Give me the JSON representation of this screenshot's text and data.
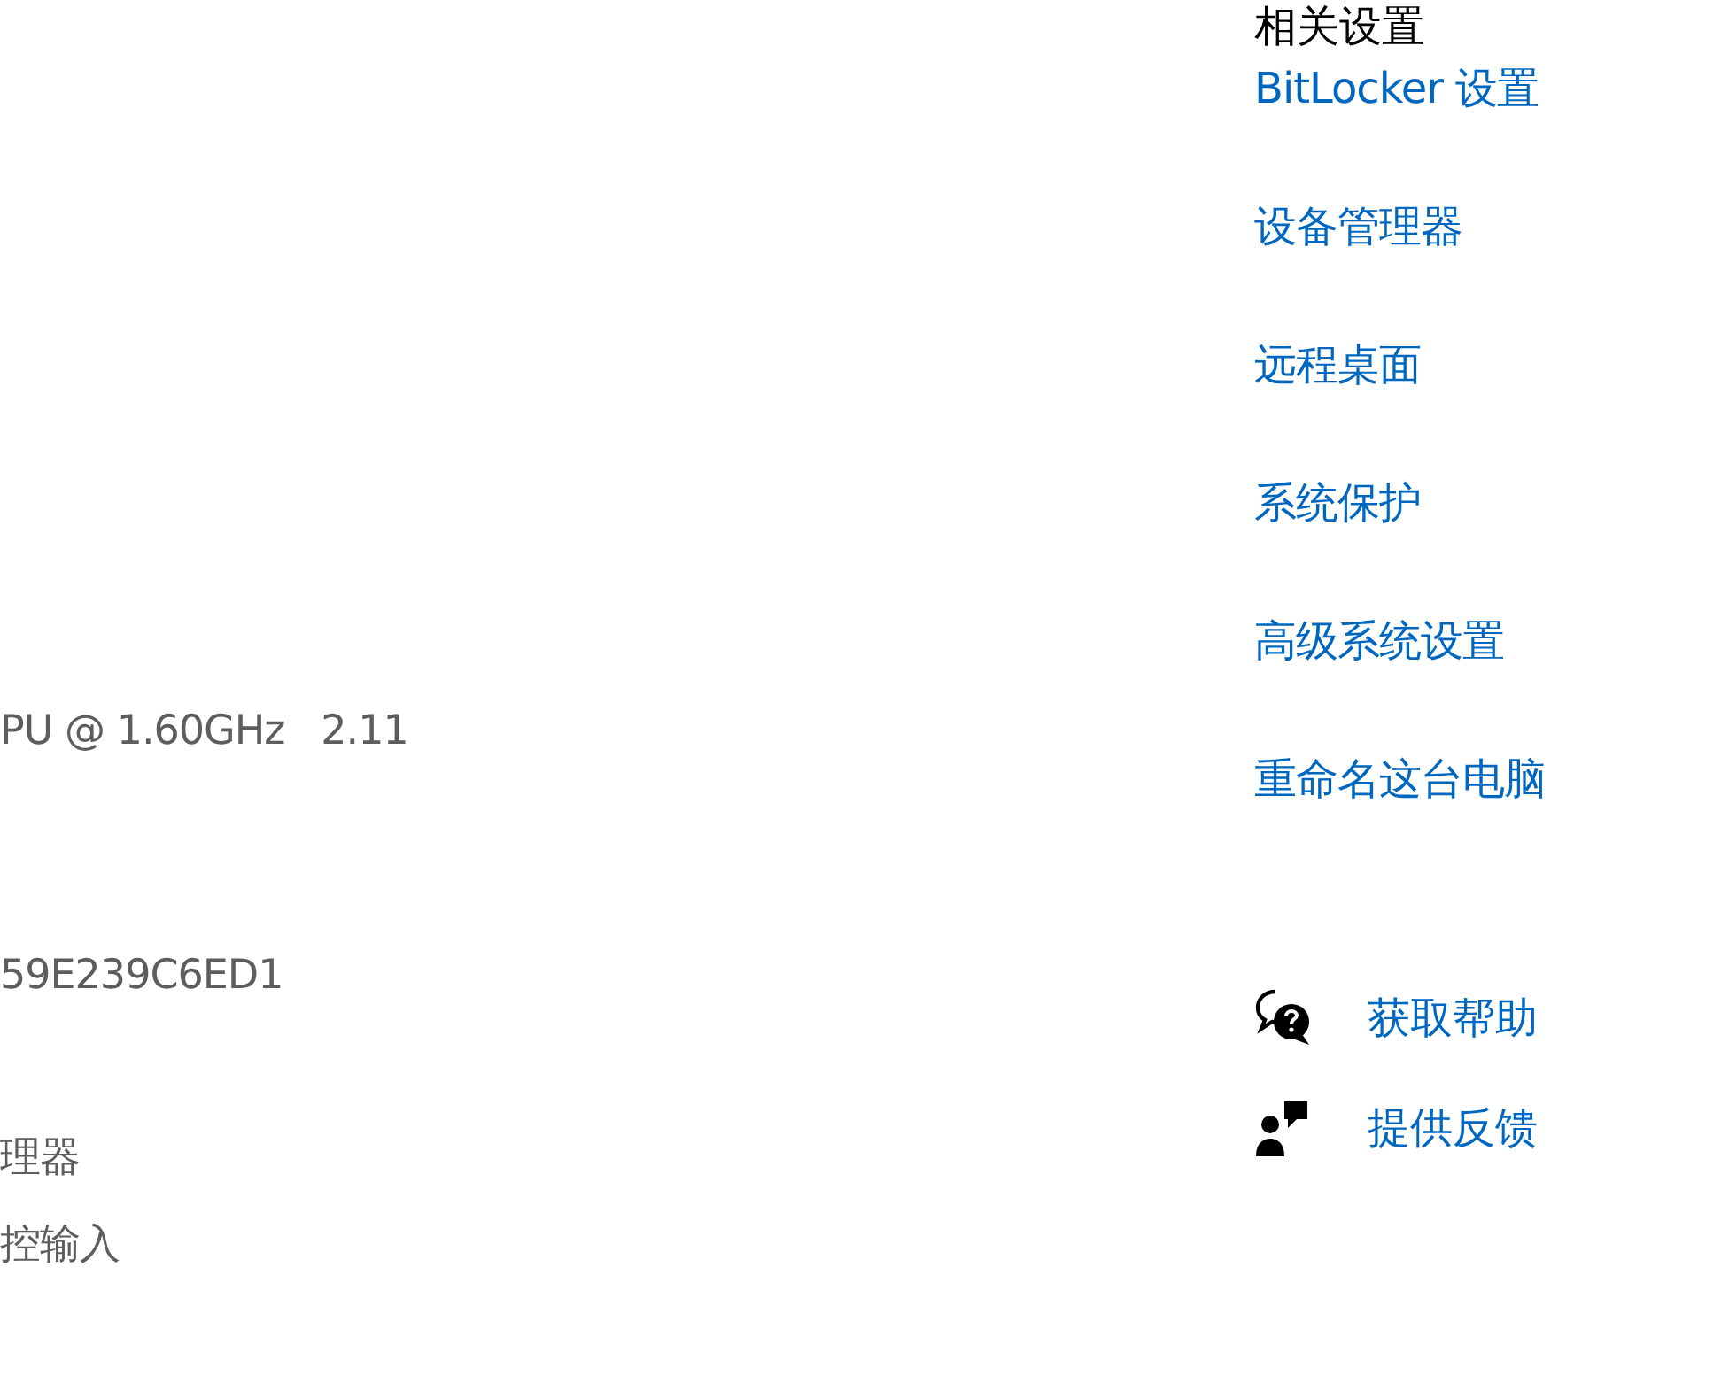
{
  "specs": [
    {
      "value": "PU @ 1.60GHz   2.11"
    },
    {
      "value": "59E239C6ED1"
    },
    {
      "value": "理器"
    },
    {
      "value": "控输入"
    }
  ],
  "related_settings": {
    "title": "相关设置",
    "links": [
      "BitLocker 设置",
      "设备管理器",
      "远程桌面",
      "系统保护",
      "高级系统设置",
      "重命名这台电脑"
    ]
  },
  "support_links": [
    {
      "kind": "help",
      "label": "获取帮助"
    },
    {
      "kind": "feedback",
      "label": "提供反馈"
    }
  ]
}
